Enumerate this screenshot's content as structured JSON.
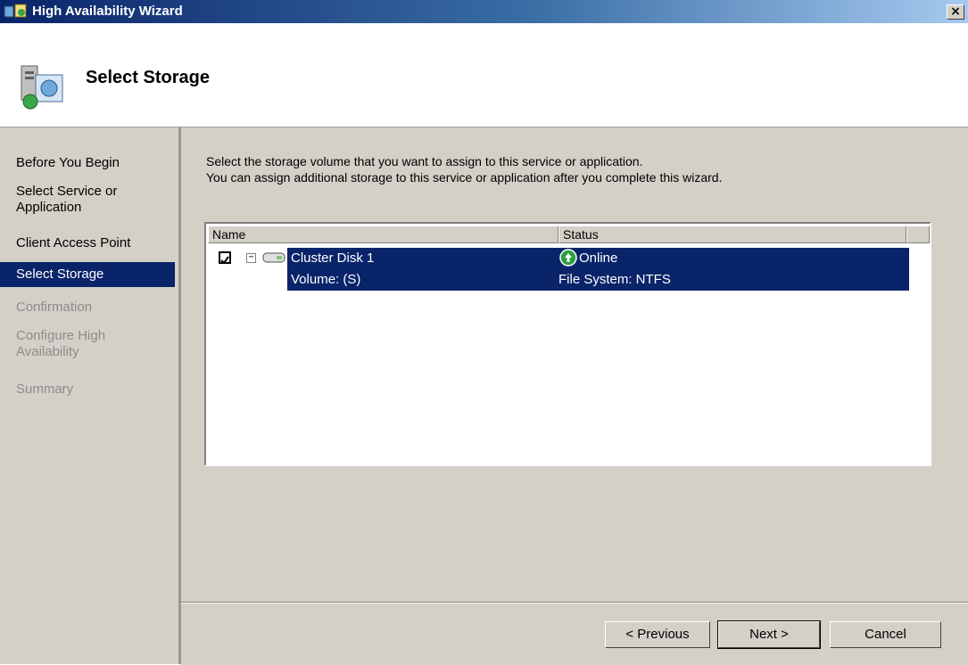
{
  "window": {
    "title": "High Availability Wizard",
    "close_label": "×"
  },
  "header": {
    "title": "Select Storage"
  },
  "nav": {
    "items": [
      {
        "label": "Before You Begin",
        "state": "normal"
      },
      {
        "label": "Select Service or Application",
        "state": "normal"
      },
      {
        "label": "Client Access Point",
        "state": "normal"
      },
      {
        "label": "Select Storage",
        "state": "selected"
      },
      {
        "label": "Confirmation",
        "state": "disabled"
      },
      {
        "label": "Configure High Availability",
        "state": "disabled"
      },
      {
        "label": "Summary",
        "state": "disabled"
      }
    ]
  },
  "content": {
    "desc_line1": "Select the storage volume that you want to assign to this service or application.",
    "desc_line2": "You can assign additional storage to this service or application after you complete this wizard."
  },
  "storage_list": {
    "columns": [
      "Name",
      "Status"
    ],
    "rows": [
      {
        "name": "Cluster Disk 1",
        "subname": "Volume: (S)",
        "status": "Online",
        "substatus": "File System: NTFS",
        "checked": true
      }
    ]
  },
  "buttons": {
    "previous": "< Previous",
    "next": "Next >",
    "cancel": "Cancel"
  },
  "colors": {
    "selection": "#0a246a",
    "dialog_bg": "#d4d0c8",
    "online_green": "#2ea043"
  },
  "icons": {
    "title": "cluster-wizard-icon",
    "header": "storage-wizard-icon",
    "disk": "disk-icon",
    "status": "online-status-icon"
  }
}
